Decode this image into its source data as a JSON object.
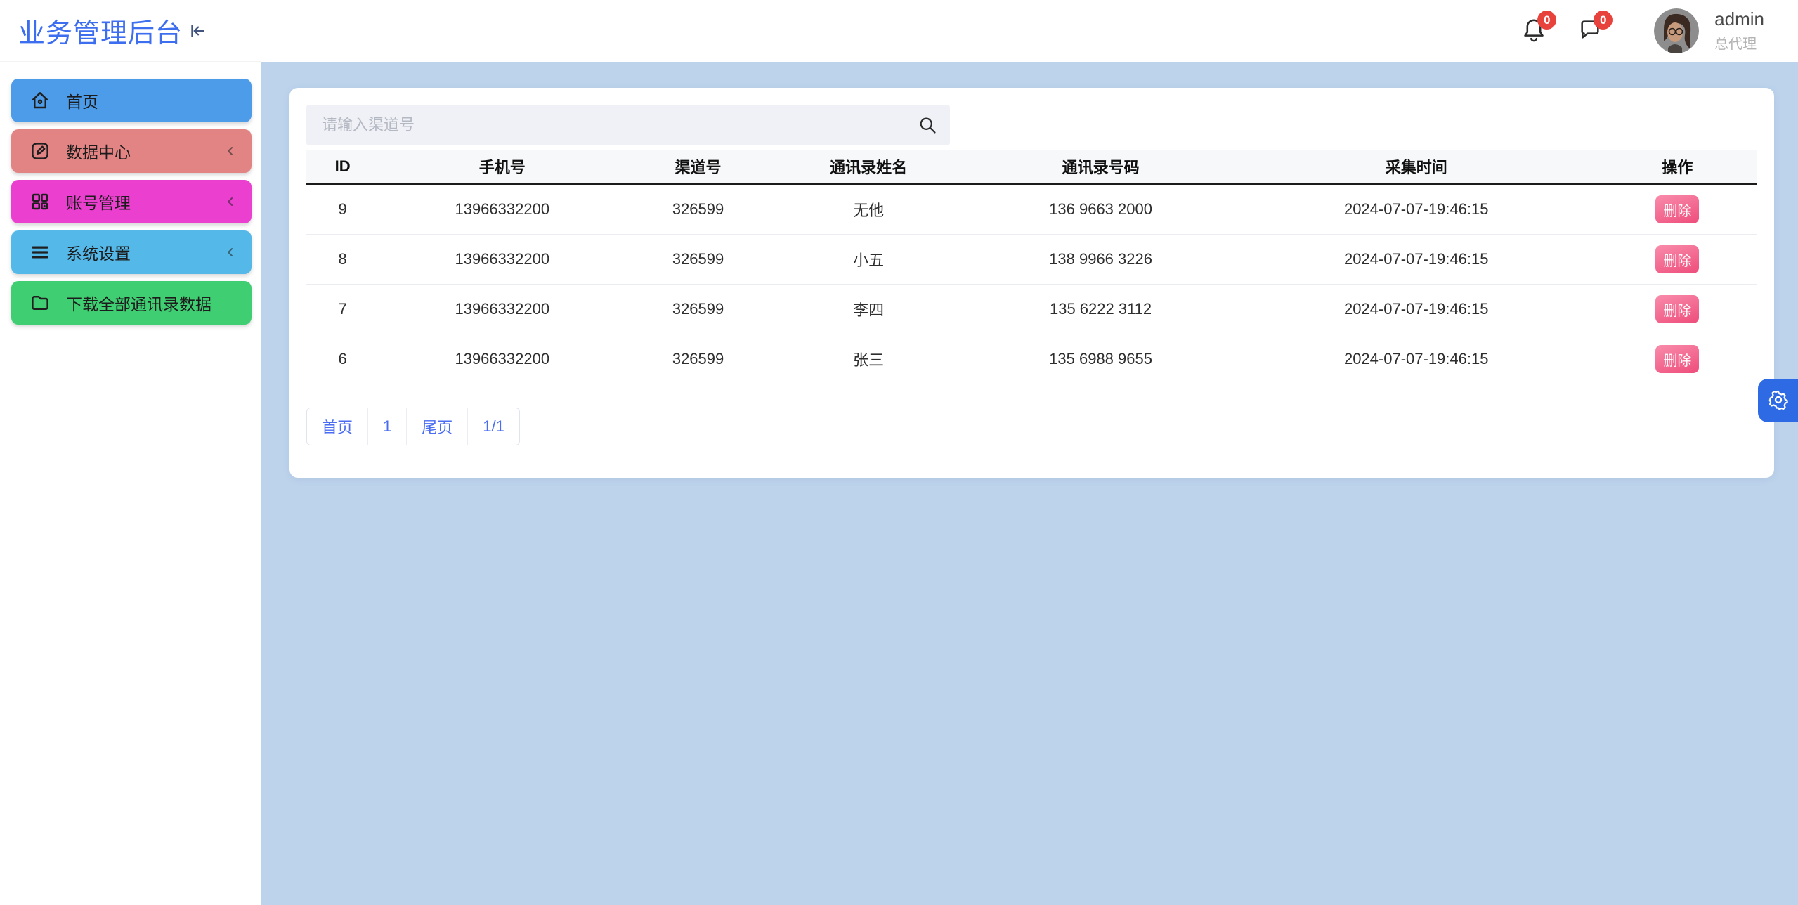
{
  "app": {
    "title": "业务管理后台"
  },
  "header": {
    "badges": [
      {
        "key": "notifications",
        "icon": "bell-icon",
        "count": "0"
      },
      {
        "key": "messages",
        "icon": "message-icon",
        "count": "0"
      }
    ],
    "user": {
      "name": "admin",
      "role": "总代理"
    }
  },
  "sidebar": {
    "items": [
      {
        "key": "home",
        "label": "首页",
        "icon": "home-icon",
        "color": "#4d9cea",
        "has_submenu": false
      },
      {
        "key": "data-center",
        "label": "数据中心",
        "icon": "edit-icon",
        "color": "#e28484",
        "has_submenu": true
      },
      {
        "key": "accounts",
        "label": "账号管理",
        "icon": "grid-icon",
        "color": "#ea3fcf",
        "has_submenu": true
      },
      {
        "key": "settings",
        "label": "系统设置",
        "icon": "menu-icon",
        "color": "#54b9e9",
        "has_submenu": true
      },
      {
        "key": "download",
        "label": "下载全部通讯录数据",
        "icon": "folder-icon",
        "color": "#40ce73",
        "has_submenu": false
      }
    ]
  },
  "search": {
    "placeholder": "请输入渠道号"
  },
  "table": {
    "columns": [
      "ID",
      "手机号",
      "渠道号",
      "通讯录姓名",
      "通讯录号码",
      "采集时间",
      "操作"
    ],
    "rows": [
      {
        "id": "9",
        "phone": "13966332200",
        "channel": "326599",
        "contact_name": "无他",
        "contact_number": "136 9663 2000",
        "collect_time": "2024-07-07-19:46:15",
        "action": "删除"
      },
      {
        "id": "8",
        "phone": "13966332200",
        "channel": "326599",
        "contact_name": "小五",
        "contact_number": "138 9966 3226",
        "collect_time": "2024-07-07-19:46:15",
        "action": "删除"
      },
      {
        "id": "7",
        "phone": "13966332200",
        "channel": "326599",
        "contact_name": "李四",
        "contact_number": "135 6222 3112",
        "collect_time": "2024-07-07-19:46:15",
        "action": "删除"
      },
      {
        "id": "6",
        "phone": "13966332200",
        "channel": "326599",
        "contact_name": "张三",
        "contact_number": "135 6988 9655",
        "collect_time": "2024-07-07-19:46:15",
        "action": "删除"
      }
    ]
  },
  "pagination": {
    "items": [
      {
        "label": "首页",
        "type": "button"
      },
      {
        "label": "1",
        "type": "page-current"
      },
      {
        "label": "尾页",
        "type": "button"
      },
      {
        "label": "1/1",
        "type": "indicator"
      }
    ]
  },
  "colors": {
    "accent": "#3e6ef0",
    "content-bg": "#bdd3ec",
    "badge": "#e8423c",
    "pagination": "#4a6cf3",
    "gear-btn": "#2d6ae4",
    "del-a": "#f98cab",
    "del-b": "#ee4d7b"
  }
}
